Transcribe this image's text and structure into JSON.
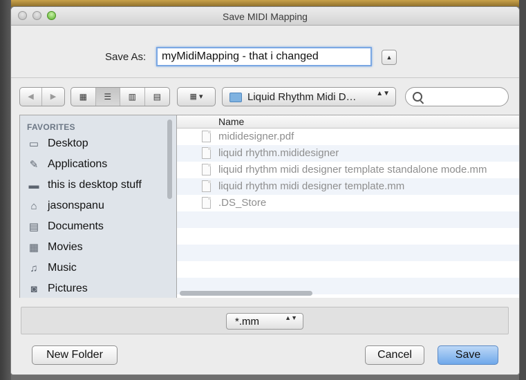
{
  "window": {
    "title": "Save MIDI Mapping"
  },
  "save_as": {
    "label": "Save As:",
    "value": "myMidiMapping - that i changed",
    "expand_icon": "▲"
  },
  "toolbar": {
    "back_icon": "◀",
    "forward_icon": "▶",
    "view_icons": [
      "▦",
      "☰",
      "▥",
      "▤"
    ],
    "arrange_icon": "▦ ▾",
    "location": {
      "name": "Liquid Rhythm Midi D…",
      "arrows": "▲▼"
    },
    "search": {
      "value": "",
      "placeholder": ""
    }
  },
  "sidebar": {
    "heading": "FAVORITES",
    "items": [
      {
        "label": "Desktop",
        "icon": "desktop-icon",
        "glyph": "▭"
      },
      {
        "label": "Applications",
        "icon": "applications-icon",
        "glyph": "✎"
      },
      {
        "label": "this is desktop stuff",
        "icon": "folder-icon",
        "glyph": "▬"
      },
      {
        "label": "jasonspanu",
        "icon": "home-icon",
        "glyph": "⌂"
      },
      {
        "label": "Documents",
        "icon": "documents-icon",
        "glyph": "▤"
      },
      {
        "label": "Movies",
        "icon": "movies-icon",
        "glyph": "▦"
      },
      {
        "label": "Music",
        "icon": "music-icon",
        "glyph": "♫"
      },
      {
        "label": "Pictures",
        "icon": "pictures-icon",
        "glyph": "◙"
      }
    ]
  },
  "file_list": {
    "column_header": "Name",
    "files": [
      {
        "name": "mididesigner.pdf"
      },
      {
        "name": "liquid rhythm.mididesigner"
      },
      {
        "name": "liquid rhythm midi designer template standalone mode.mm"
      },
      {
        "name": "liquid rhythm midi designer template.mm"
      },
      {
        "name": ".DS_Store"
      }
    ]
  },
  "format": {
    "value": "*.mm",
    "arrows": "▲▼"
  },
  "buttons": {
    "new_folder": "New Folder",
    "cancel": "Cancel",
    "save": "Save"
  }
}
